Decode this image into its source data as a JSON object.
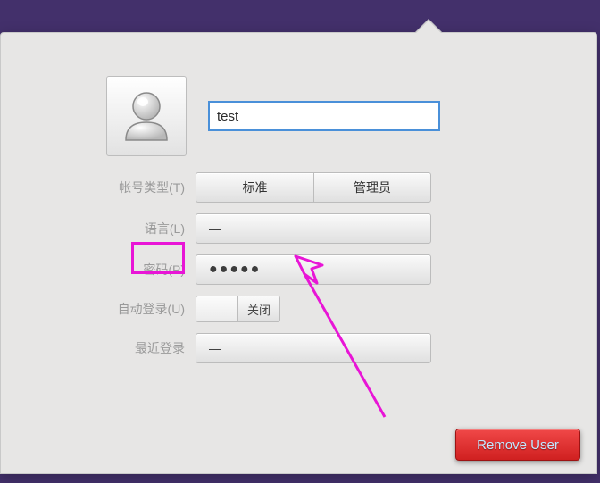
{
  "header": {
    "username": "test"
  },
  "labels": {
    "account_type": "帐号类型(T)",
    "language": "语言(L)",
    "password": "密码(P)",
    "auto_login": "自动登录(U)",
    "last_login": "最近登录"
  },
  "account_type": {
    "standard": "标准",
    "admin": "管理员",
    "selected": "standard"
  },
  "language": {
    "value": "—"
  },
  "password": {
    "display": "●●●●●"
  },
  "auto_login": {
    "state_label": "关闭",
    "on": false
  },
  "last_login": {
    "value": "—"
  },
  "footer": {
    "remove_user": "Remove User"
  },
  "annotation": {
    "highlight_label": "language",
    "arrow_points_to": "language-selector"
  }
}
